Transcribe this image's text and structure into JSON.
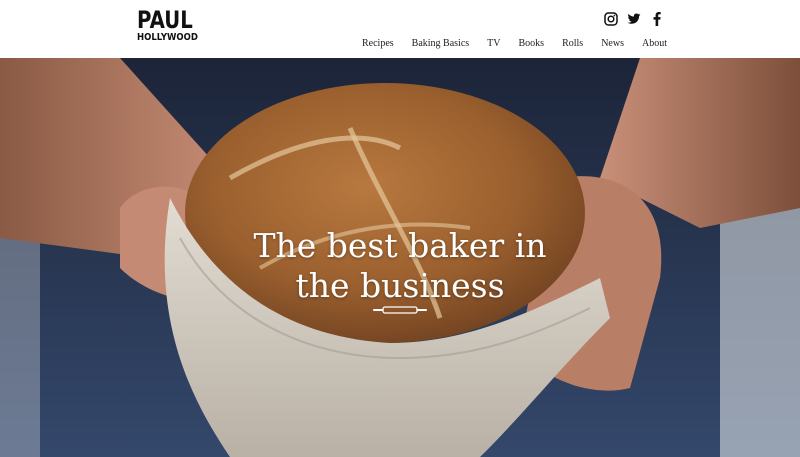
{
  "brand": {
    "line1": "PAUL",
    "line2": "HOLLYWOOD"
  },
  "social": [
    {
      "icon": "instagram-icon"
    },
    {
      "icon": "twitter-icon"
    },
    {
      "icon": "facebook-icon"
    }
  ],
  "nav": {
    "items": [
      {
        "label": "Recipes"
      },
      {
        "label": "Baking Basics"
      },
      {
        "label": "TV"
      },
      {
        "label": "Books"
      },
      {
        "label": "Rolls"
      },
      {
        "label": "News"
      },
      {
        "label": "About"
      }
    ]
  },
  "hero": {
    "headline_line1": "The best baker in",
    "headline_line2": "the business",
    "divider_icon": "rolling-pin-icon"
  },
  "colors": {
    "header_bg": "#ffffff",
    "text_dark": "#222222",
    "headline": "#ffffff"
  }
}
